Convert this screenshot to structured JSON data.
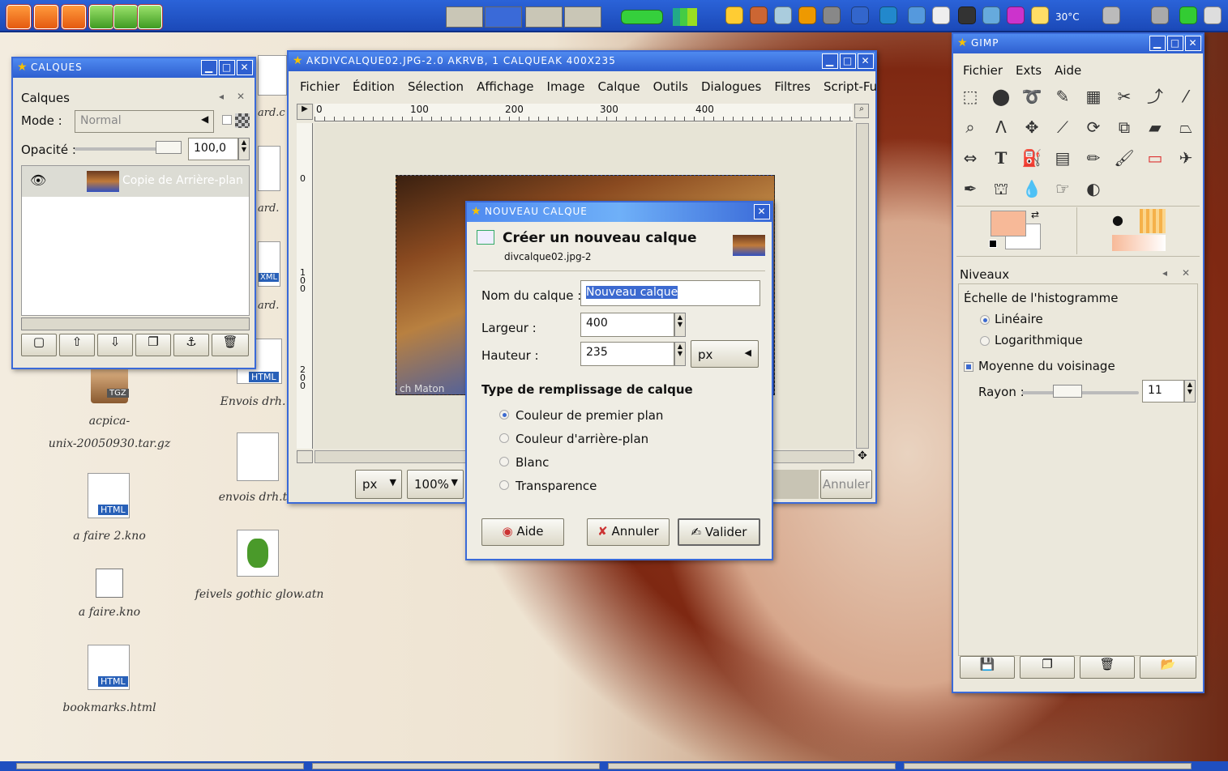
{
  "layers_window": {
    "title": "CALQUES",
    "panel_title": "Calques",
    "mode_label": "Mode :",
    "mode_value": "Normal",
    "opacity_label": "Opacité :",
    "opacity_value": "100,0",
    "layer_name": "Copie de Arrière-plan"
  },
  "image_window": {
    "title": "AKDIVCALQUE02.JPG-2.0 AKRVB, 1 CALQUEAK 400X235",
    "menu": [
      "Fichier",
      "Édition",
      "Sélection",
      "Affichage",
      "Image",
      "Calque",
      "Outils",
      "Dialogues",
      "Filtres",
      "Script-Fu"
    ],
    "ruler_ticks": [
      "0",
      "100",
      "200",
      "300",
      "400"
    ],
    "vruler_ticks": [
      "0",
      "1 0 0",
      "2 0 0"
    ],
    "unit": "px",
    "zoom": "100%",
    "cancel": "Annuler",
    "watermark": "ch Maton"
  },
  "dialog": {
    "title": "NOUVEAU CALQUE",
    "heading": "Créer un nouveau calque",
    "subheading": "divcalque02.jpg-2",
    "name_label": "Nom du calque :",
    "name_value": "Nouveau calque",
    "width_label": "Largeur :",
    "width_value": "400",
    "height_label": "Hauteur :",
    "height_value": "235",
    "unit": "px",
    "fill_heading": "Type de remplissage de calque",
    "fill_options": [
      "Couleur de premier plan",
      "Couleur d'arrière-plan",
      "Blanc",
      "Transparence"
    ],
    "help": "Aide",
    "cancel": "Annuler",
    "ok": "Valider"
  },
  "gimp_window": {
    "title": "GIMP",
    "menu": [
      "Fichier",
      "Exts",
      "Aide"
    ],
    "levels": {
      "title": "Niveaux",
      "scale_heading": "Échelle de l'histogramme",
      "linear": "Linéaire",
      "log": "Logarithmique",
      "average": "Moyenne du voisinage",
      "radius_label": "Rayon :",
      "radius_value": "11"
    }
  },
  "desktop_icons": [
    {
      "label": "acpica-",
      "label2": "unix-20050930.tar.gz",
      "badge": "TGZ"
    },
    {
      "label": "a faire 2.kno",
      "badge": "HTML"
    },
    {
      "label": "a faire.kno"
    },
    {
      "label": "bookmarks.html",
      "badge": "HTML"
    },
    {
      "label": "Envois drh.",
      "badge": "HTML"
    },
    {
      "label": "envois drh.t"
    },
    {
      "label": "feivels gothic glow.atn"
    },
    {
      "label": "ard.c"
    },
    {
      "label": "ard."
    },
    {
      "label": "ard."
    },
    {
      "badge": "XML"
    }
  ],
  "tray": {
    "temp": "30°C"
  },
  "colors": {
    "accent": "#2e5fd0",
    "fg_color": "#f7b998",
    "bg_color": "#ffffff"
  }
}
